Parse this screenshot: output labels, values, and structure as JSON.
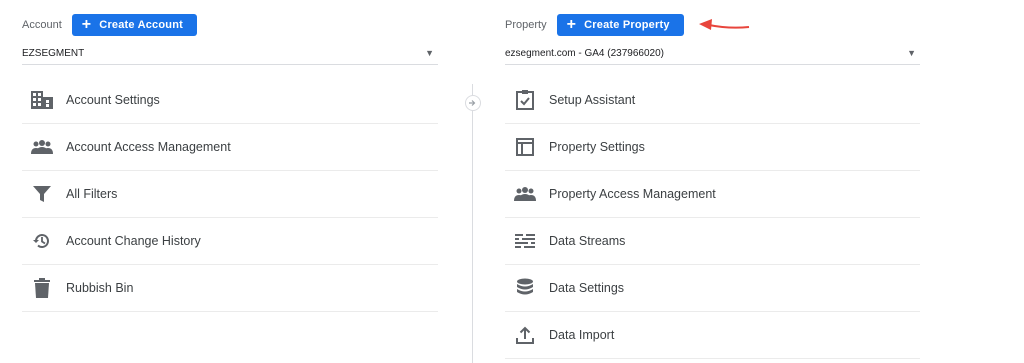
{
  "account": {
    "label": "Account",
    "create_button": "Create Account",
    "selected": "EZSEGMENT",
    "items": [
      {
        "label": "Account Settings",
        "icon": "building-icon"
      },
      {
        "label": "Account Access Management",
        "icon": "people-icon"
      },
      {
        "label": "All Filters",
        "icon": "filter-icon"
      },
      {
        "label": "Account Change History",
        "icon": "history-icon"
      },
      {
        "label": "Rubbish Bin",
        "icon": "trash-icon"
      }
    ]
  },
  "property": {
    "label": "Property",
    "create_button": "Create Property",
    "selected": "ezsegment.com - GA4 (237966020)",
    "items": [
      {
        "label": "Setup Assistant",
        "icon": "clipboard-check-icon"
      },
      {
        "label": "Property Settings",
        "icon": "layout-icon"
      },
      {
        "label": "Property Access Management",
        "icon": "people-icon"
      },
      {
        "label": "Data Streams",
        "icon": "streams-icon"
      },
      {
        "label": "Data Settings",
        "icon": "database-icon"
      },
      {
        "label": "Data Import",
        "icon": "upload-icon"
      }
    ]
  },
  "colors": {
    "accent": "#1a73e8",
    "annotation": "#e8453c",
    "icon": "#5f6368"
  }
}
